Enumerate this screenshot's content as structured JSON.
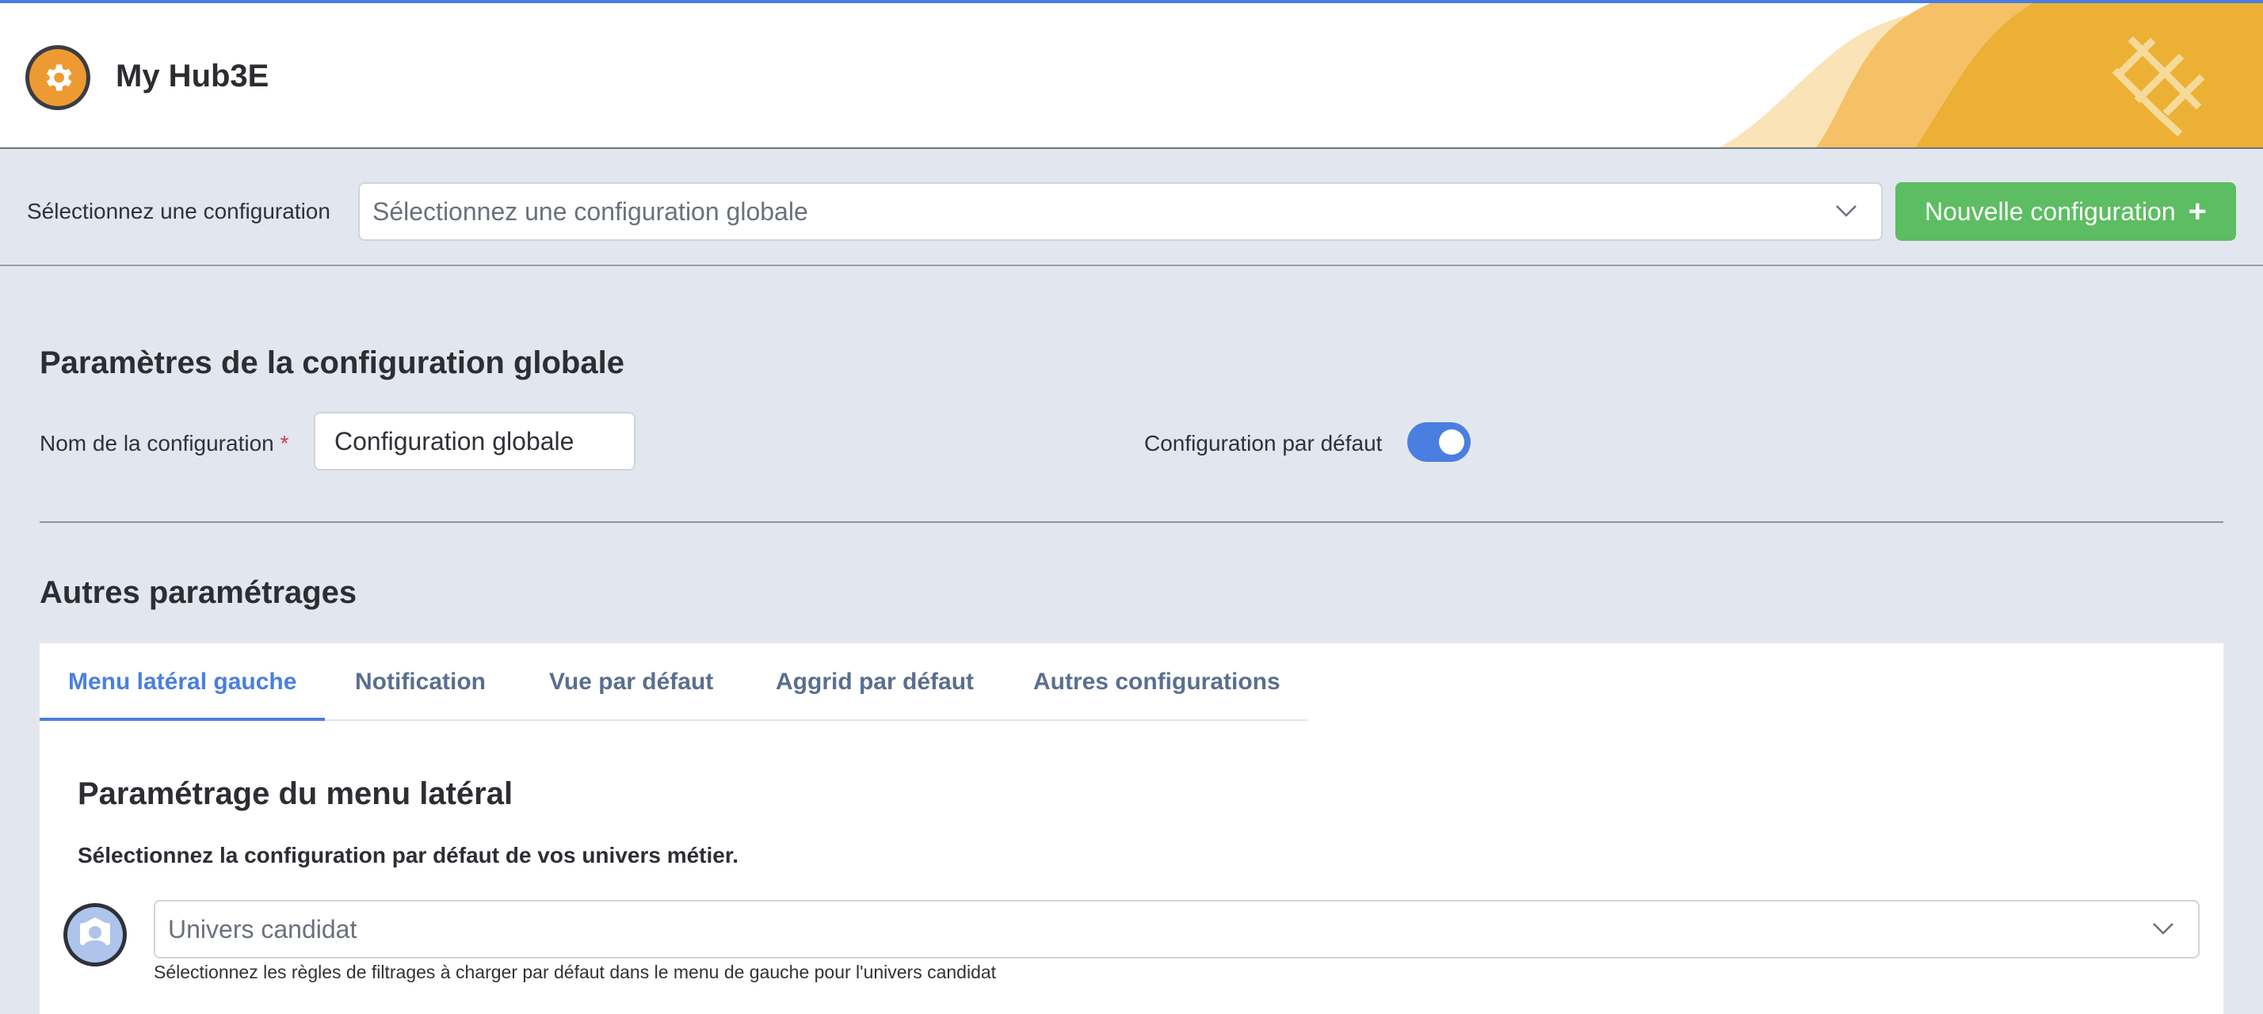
{
  "app": {
    "title": "My Hub3E",
    "logo_icon": "gear-icon",
    "colors": {
      "accent": "#4a7fe0",
      "success": "#5dbd62",
      "logo": "#ee9a32"
    }
  },
  "toolbar": {
    "label": "Sélectionnez une configuration",
    "select_placeholder": "Sélectionnez une configuration globale",
    "new_button_label": "Nouvelle configuration"
  },
  "params": {
    "title": "Paramètres de la configuration globale",
    "name_label": "Nom de la configuration",
    "required_marker": "*",
    "name_value": "Configuration globale",
    "default_label": "Configuration par défaut",
    "default_enabled": true
  },
  "other": {
    "title": "Autres paramétrages",
    "tabs": [
      {
        "label": "Menu latéral gauche",
        "active": true
      },
      {
        "label": "Notification",
        "active": false
      },
      {
        "label": "Vue par défaut",
        "active": false
      },
      {
        "label": "Aggrid par défaut",
        "active": false
      },
      {
        "label": "Autres configurations",
        "active": false
      }
    ]
  },
  "menu": {
    "title": "Paramétrage du menu latéral",
    "description": "Sélectionnez la configuration par défaut de vos univers métier.",
    "univers_placeholder": "Univers candidat",
    "univers_icon": "candidate-avatar-icon",
    "helper": "Sélectionnez les règles de filtrages à charger par défaut dans le menu de gauche pour l'univers candidat"
  }
}
